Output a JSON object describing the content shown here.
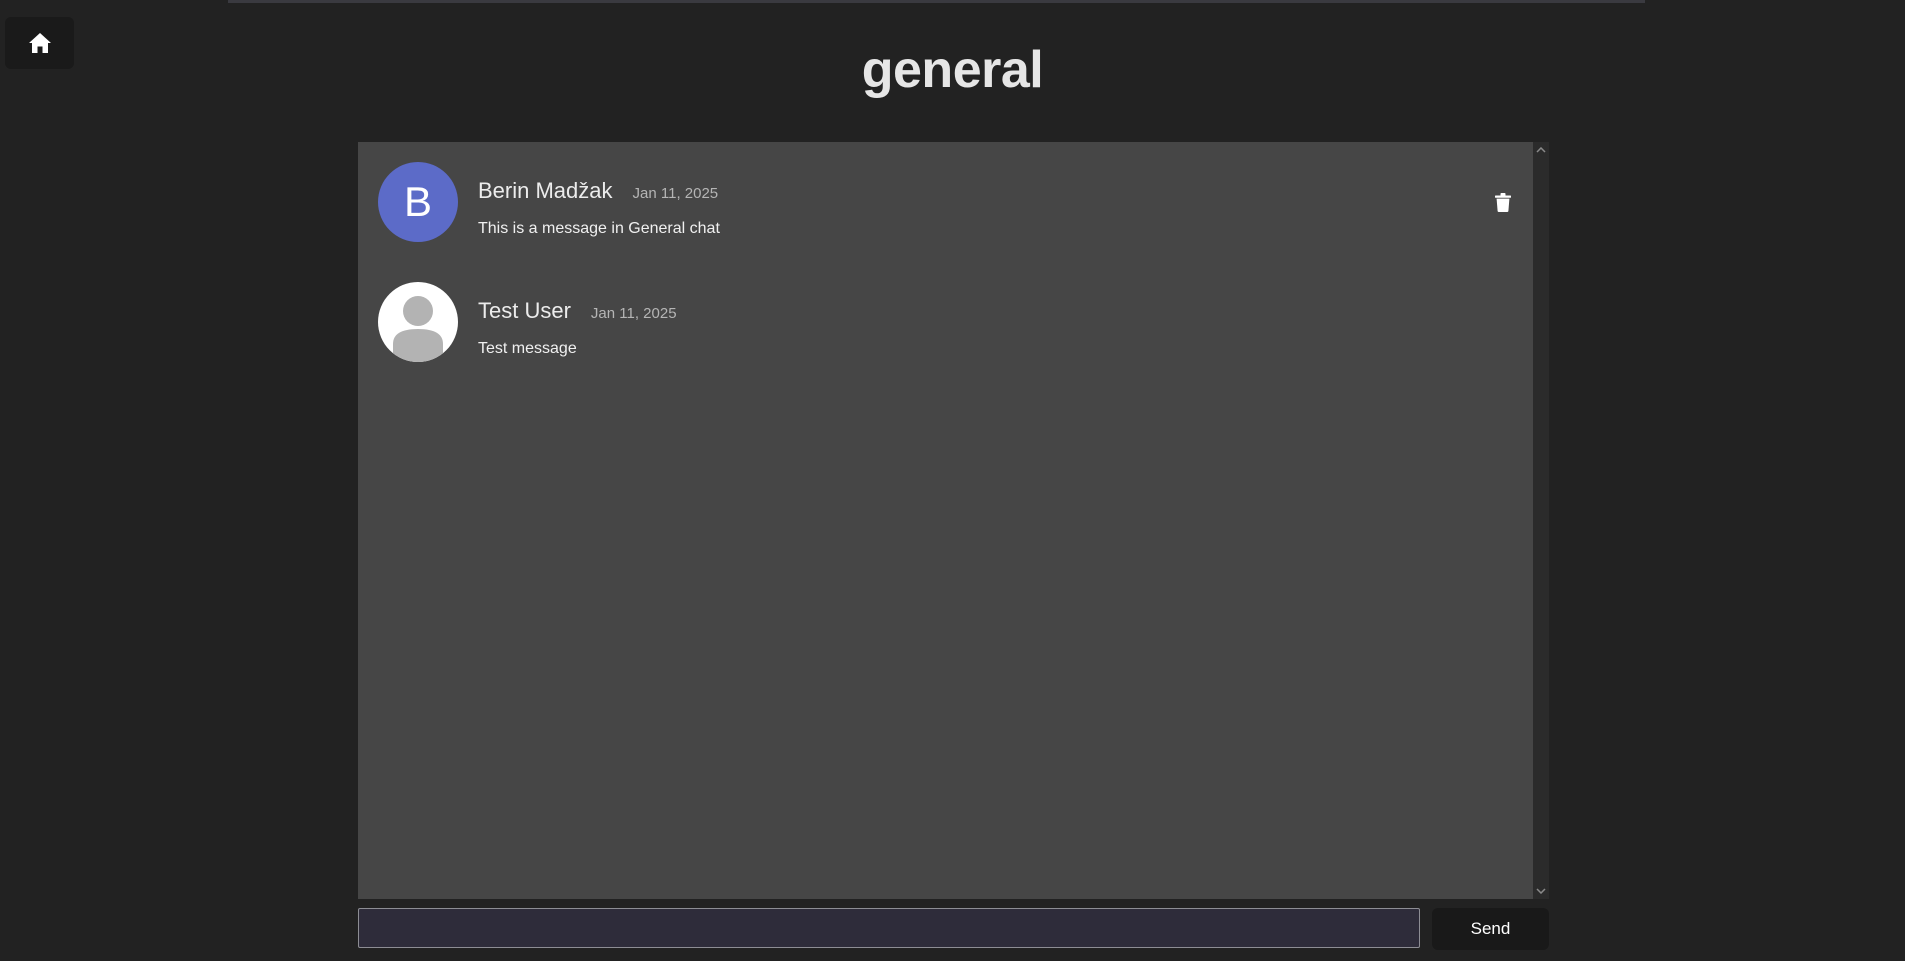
{
  "header": {
    "home_icon": "home-icon",
    "title": "general"
  },
  "messages": [
    {
      "author": "Berin Madžak",
      "timestamp": "Jan 11, 2025",
      "text": "This is a message in General chat",
      "avatar_letter": "B",
      "avatar_color": "#5c6bc8",
      "delete_icon": "trash-icon"
    },
    {
      "author": "Test User",
      "timestamp": "Jan 11, 2025",
      "text": "Test message",
      "avatar_icon": "default-user-icon"
    }
  ],
  "composer": {
    "input_value": "",
    "send_label": "Send"
  }
}
